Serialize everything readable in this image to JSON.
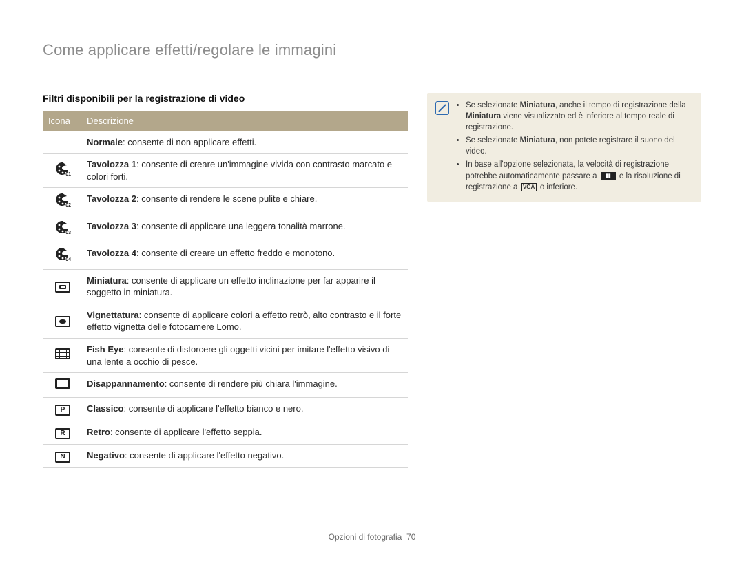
{
  "page_title": "Come applicare effetti/regolare le immagini",
  "subheading": "Filtri disponibili per la registrazione di video",
  "table": {
    "headers": {
      "icon": "Icona",
      "desc": "Descrizione"
    },
    "rows": [
      {
        "icon_name": "filter-off-icon",
        "name": "Normale",
        "desc": ": consente di non applicare effetti."
      },
      {
        "icon_name": "palette-1-icon",
        "sub": "01",
        "name": "Tavolozza 1",
        "desc": ": consente di creare un'immagine vivida con contrasto marcato e colori forti."
      },
      {
        "icon_name": "palette-2-icon",
        "sub": "02",
        "name": "Tavolozza 2",
        "desc": ": consente di rendere le scene pulite e chiare."
      },
      {
        "icon_name": "palette-3-icon",
        "sub": "03",
        "name": "Tavolozza 3",
        "desc": ": consente di applicare una leggera tonalità marrone."
      },
      {
        "icon_name": "palette-4-icon",
        "sub": "04",
        "name": "Tavolozza 4",
        "desc": ": consente di creare un effetto freddo e monotono."
      },
      {
        "icon_name": "miniature-icon",
        "name": "Miniatura",
        "desc": ": consente di applicare un effetto inclinazione per far apparire il soggetto in miniatura."
      },
      {
        "icon_name": "vignette-icon",
        "name": "Vignettatura",
        "desc": ": consente di applicare colori a effetto retrò, alto contrasto e il forte effetto vignetta delle fotocamere Lomo."
      },
      {
        "icon_name": "fisheye-icon",
        "name": "Fish Eye",
        "desc": ": consente di distorcere gli oggetti vicini per imitare l'effetto visivo di una lente a occhio di pesce."
      },
      {
        "icon_name": "defog-icon",
        "name": "Disappannamento",
        "desc": ": consente di rendere più chiara l'immagine."
      },
      {
        "icon_name": "classic-icon",
        "letter": "P",
        "name": "Classico",
        "desc": ": consente di applicare l'effetto bianco e nero."
      },
      {
        "icon_name": "retro-icon",
        "letter": "R",
        "name": "Retro",
        "desc": ": consente di applicare l'effetto seppia."
      },
      {
        "icon_name": "negative-icon",
        "letter": "N",
        "name": "Negativo",
        "desc": ": consente di applicare l'effetto negativo."
      }
    ]
  },
  "notes": {
    "items": [
      {
        "pre": "Se selezionate ",
        "b1": "Miniatura",
        "mid": ", anche il tempo di registrazione della ",
        "b2": "Miniatura",
        "post": " viene visualizzato ed è inferiore al tempo reale di registrazione."
      },
      {
        "pre": "Se selezionate ",
        "b1": "Miniatura",
        "post": ", non potete registrare il suono del video."
      },
      {
        "pre": "In base all'opzione selezionata, la velocità di registrazione potrebbe automaticamente passare a ",
        "g1": "fps-icon",
        "mid2": " e la risoluzione di registrazione a ",
        "g2": "vga-icon",
        "post2": " o inferiore."
      }
    ]
  },
  "footer": {
    "label": "Opzioni di fotografia",
    "page": "70"
  }
}
